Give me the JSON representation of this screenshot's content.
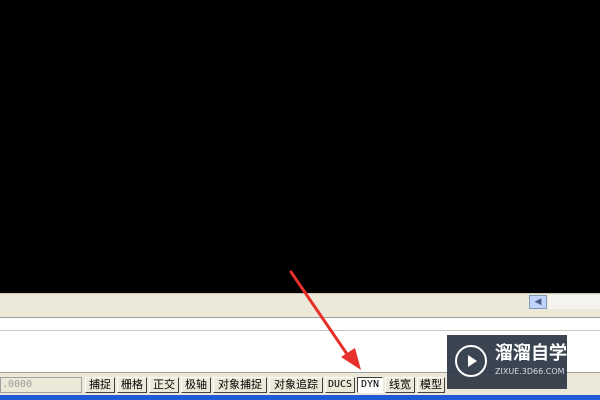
{
  "status_bar": {
    "coordinates": ".0000",
    "buttons": [
      {
        "label": "捕捉",
        "on": false
      },
      {
        "label": "栅格",
        "on": false
      },
      {
        "label": "正交",
        "on": false
      },
      {
        "label": "极轴",
        "on": false
      },
      {
        "label": "对象捕捉",
        "on": false
      },
      {
        "label": "对象追踪",
        "on": false
      },
      {
        "label": "DUCS",
        "on": false
      },
      {
        "label": "DYN",
        "on": true
      },
      {
        "label": "线宽",
        "on": false
      },
      {
        "label": "模型",
        "on": false
      }
    ]
  },
  "scrollbar": {
    "left_arrow_icon": "chevron-left-icon"
  },
  "annotation": {
    "arrow_color": "#e8302a"
  },
  "watermark": {
    "title": "溜溜自学",
    "url": "ZIXUE.3D66.COM",
    "background": "#2b3543"
  },
  "colors": {
    "canvas": "#000000",
    "window": "#ece9d8",
    "taskbar": "#1f5bd6"
  }
}
